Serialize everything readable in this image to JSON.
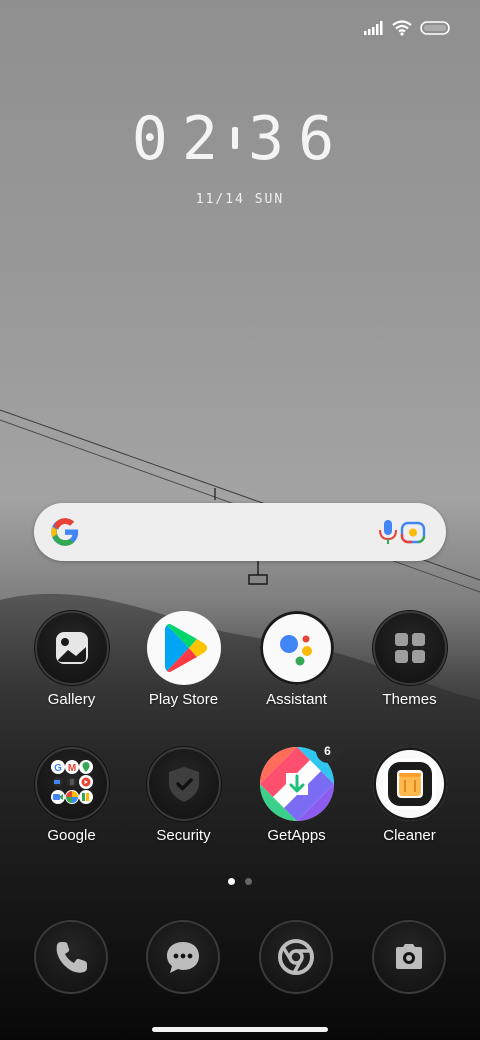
{
  "status_bar": {
    "icons": [
      "signal-icon",
      "wifi-icon",
      "battery-icon"
    ]
  },
  "clock": {
    "hours": "02",
    "minutes": "36"
  },
  "date": "11/14 SUN",
  "search": {
    "icons": [
      "google-logo-icon",
      "microphone-icon",
      "google-lens-icon"
    ]
  },
  "apps_row1": [
    {
      "label": "Gallery",
      "icon": "gallery-icon"
    },
    {
      "label": "Play Store",
      "icon": "play-store-icon"
    },
    {
      "label": "Assistant",
      "icon": "assistant-icon"
    },
    {
      "label": "Themes",
      "icon": "themes-icon"
    }
  ],
  "apps_row2": [
    {
      "label": "Google",
      "icon": "google-folder-icon"
    },
    {
      "label": "Security",
      "icon": "security-shield-icon"
    },
    {
      "label": "GetApps",
      "icon": "getapps-icon",
      "badge": "6"
    },
    {
      "label": "Cleaner",
      "icon": "cleaner-icon"
    }
  ],
  "page_indicator": {
    "pages": 2,
    "active": 1
  },
  "dock": [
    "phone-icon",
    "messages-icon",
    "chrome-icon",
    "camera-icon"
  ],
  "colors": {
    "google_blue": "#4285F4",
    "google_red": "#EA4335",
    "google_yellow": "#FBBC05",
    "google_green": "#34A853"
  }
}
